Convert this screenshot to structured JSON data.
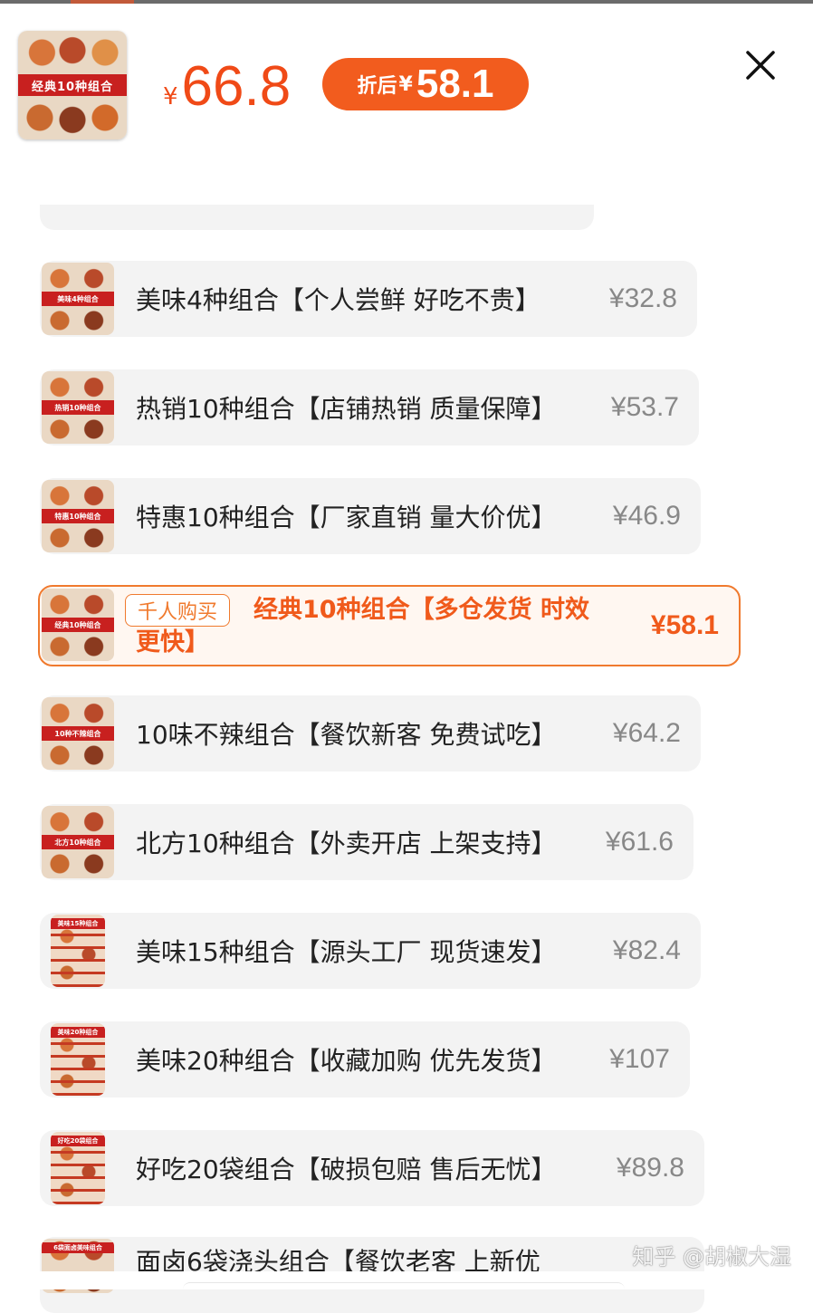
{
  "header": {
    "thumb_title": "经典10种组合",
    "currency": "¥",
    "price": "66.8",
    "discount_label": "折后",
    "discount_currency": "¥",
    "discount_price": "58.1",
    "close_icon": "close-icon"
  },
  "options": [
    {
      "thumb_title": "美味4种组合",
      "name": "美味4种组合【个人尝鲜 好吃不贵】",
      "price": "¥32.8"
    },
    {
      "thumb_title": "热销10种组合",
      "name": "热销10种组合【店铺热销 质量保障】",
      "price": "¥53.7"
    },
    {
      "thumb_title": "特惠10种组合",
      "name": "特惠10种组合【厂家直销 量大价优】",
      "price": "¥46.9"
    },
    {
      "thumb_title": "经典10种组合",
      "badge": "千人购买",
      "name": "经典10种组合【多仓发货 时效更快】",
      "price": "¥58.1",
      "selected": true
    },
    {
      "thumb_title": "10种不辣组合",
      "name": "10味不辣组合【餐饮新客 免费试吃】",
      "price": "¥64.2"
    },
    {
      "thumb_title": "北方10种组合",
      "name": "北方10种组合【外卖开店 上架支持】",
      "price": "¥61.6"
    },
    {
      "thumb_title": "美味15种组合",
      "name": "美味15种组合【源头工厂 现货速发】",
      "price": "¥82.4"
    },
    {
      "thumb_title": "美味20种组合",
      "name": "美味20种组合【收藏加购 优先发货】",
      "price": "¥107"
    },
    {
      "thumb_title": "好吃20袋组合",
      "name": "好吃20袋组合【破损包赔 售后无忧】",
      "price": "¥89.8"
    },
    {
      "thumb_title": "6袋面卤美味组合",
      "name": "面卤6袋浇头组合【餐饮老客 上新优",
      "price": ""
    }
  ],
  "watermark": "知乎 @胡椒大湿",
  "colors": {
    "accent": "#f05a1b",
    "pill": "#f25c1e",
    "selected_border": "#f07a2e",
    "row_bg": "#f3f3f3"
  }
}
